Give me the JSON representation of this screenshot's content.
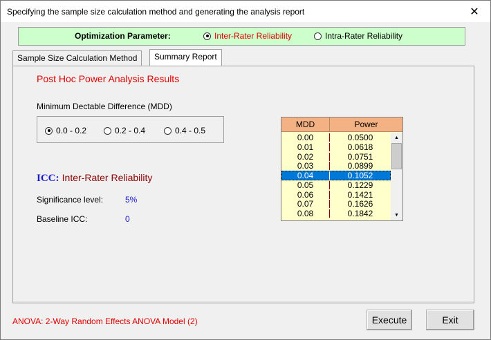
{
  "window": {
    "title": "Specifying the sample size calculation method and generating the analysis report",
    "close_label": "✕"
  },
  "optimization": {
    "label": "Optimization Parameter:",
    "options": [
      {
        "label": "Inter-Rater Reliability",
        "selected": true,
        "color": "#e00000"
      },
      {
        "label": "Intra-Rater Reliability",
        "selected": false,
        "color": "#000000"
      }
    ]
  },
  "tabs": [
    {
      "label": "Sample Size Calculation Method",
      "active": false
    },
    {
      "label": "Summary Report",
      "active": true
    }
  ],
  "report": {
    "title": "Post Hoc Power Analysis Results",
    "mdd_label": "Minimum Dectable Difference (MDD)",
    "mdd_options": [
      {
        "label": "0.0 - 0.2",
        "selected": true
      },
      {
        "label": "0.2 - 0.4",
        "selected": false
      },
      {
        "label": "0.4 - 0.5",
        "selected": false
      }
    ],
    "icc_key": "ICC:",
    "icc_value": "Inter-Rater Reliability",
    "significance_label": "Significance level:",
    "significance_value": "5%",
    "baseline_label": "Baseline ICC:",
    "baseline_value": "0"
  },
  "grid": {
    "columns": [
      "MDD",
      "Power"
    ],
    "rows": [
      {
        "mdd": "0.00",
        "power": "0.0500"
      },
      {
        "mdd": "0.01",
        "power": "0.0618"
      },
      {
        "mdd": "0.02",
        "power": "0.0751"
      },
      {
        "mdd": "0.03",
        "power": "0.0899"
      },
      {
        "mdd": "0.04",
        "power": "0.1052"
      },
      {
        "mdd": "0.05",
        "power": "0.1229"
      },
      {
        "mdd": "0.06",
        "power": "0.1421"
      },
      {
        "mdd": "0.07",
        "power": "0.1626"
      },
      {
        "mdd": "0.08",
        "power": "0.1842"
      }
    ],
    "selected_index": 4,
    "colors": {
      "header": "#f4b183",
      "body": "#ffffcc",
      "selected": "#0078d7"
    }
  },
  "footer": {
    "status": "ANOVA: 2-Way Random Effects ANOVA Model (2)",
    "execute_label": "Execute",
    "exit_label": "Exit"
  }
}
